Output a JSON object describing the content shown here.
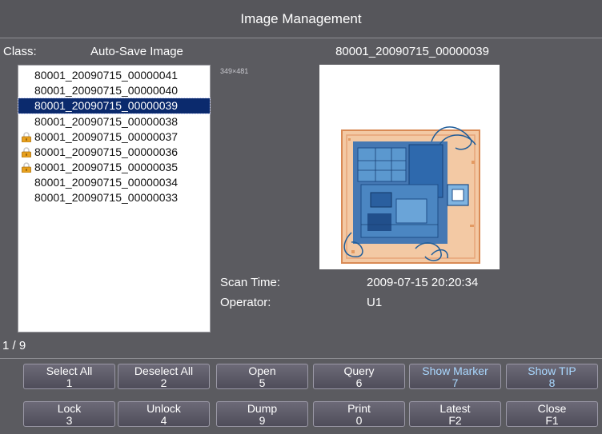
{
  "window": {
    "title": "Image Management"
  },
  "class_row": {
    "label": "Class:",
    "value": "Auto-Save Image"
  },
  "image_list": {
    "items": [
      {
        "name": "80001_20090715_00000041",
        "locked": false,
        "selected": false
      },
      {
        "name": "80001_20090715_00000040",
        "locked": false,
        "selected": false
      },
      {
        "name": "80001_20090715_00000039",
        "locked": false,
        "selected": true
      },
      {
        "name": "80001_20090715_00000038",
        "locked": false,
        "selected": false
      },
      {
        "name": "80001_20090715_00000037",
        "locked": true,
        "selected": false
      },
      {
        "name": "80001_20090715_00000036",
        "locked": true,
        "selected": false
      },
      {
        "name": "80001_20090715_00000035",
        "locked": true,
        "selected": false
      },
      {
        "name": "80001_20090715_00000034",
        "locked": false,
        "selected": false
      },
      {
        "name": "80001_20090715_00000033",
        "locked": false,
        "selected": false
      }
    ],
    "counter": "1 / 9"
  },
  "preview": {
    "filename": "80001_20090715_00000039",
    "dimensions": "349×481",
    "scan_time_label": "Scan Time:",
    "scan_time_value": "2009-07-15 20:20:34",
    "operator_label": "Operator:",
    "operator_value": "U1"
  },
  "buttons": {
    "select_all": {
      "label": "Select All",
      "key": "1"
    },
    "deselect_all": {
      "label": "Deselect All",
      "key": "2"
    },
    "open": {
      "label": "Open",
      "key": "5"
    },
    "query": {
      "label": "Query",
      "key": "6"
    },
    "show_marker": {
      "label": "Show Marker",
      "key": "7"
    },
    "show_tip": {
      "label": "Show TIP",
      "key": "8"
    },
    "lock": {
      "label": "Lock",
      "key": "3"
    },
    "unlock": {
      "label": "Unlock",
      "key": "4"
    },
    "dump": {
      "label": "Dump",
      "key": "9"
    },
    "print": {
      "label": "Print",
      "key": "0"
    },
    "latest": {
      "label": "Latest",
      "key": "F2"
    },
    "close": {
      "label": "Close",
      "key": "F1"
    }
  },
  "colors": {
    "background": "#5b5b60",
    "selection": "#0b2a6d",
    "highlight_text": "#a9d8ff",
    "lock_icon": "#e8a11e"
  }
}
